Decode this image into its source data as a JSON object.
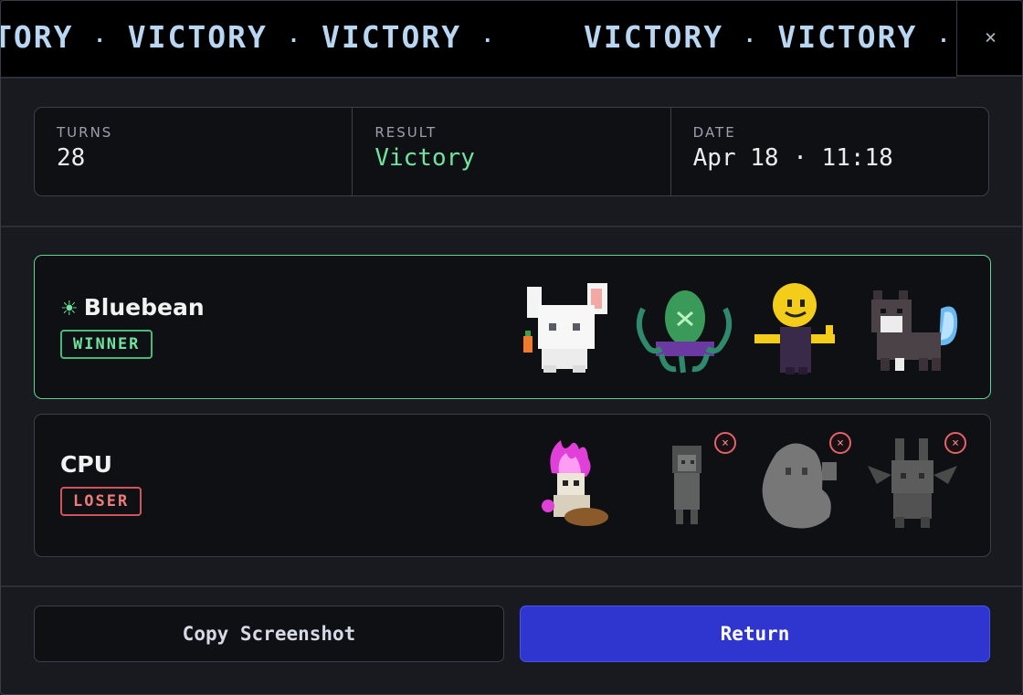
{
  "banner": {
    "word": "VICTORY",
    "separator": "·",
    "segments": [
      "TORY",
      "VICTORY",
      "VICTORY",
      "VICTORY",
      "VICTORY"
    ]
  },
  "close_label": "×",
  "stats": {
    "turns": {
      "label": "TURNS",
      "value": "28"
    },
    "result": {
      "label": "RESULT",
      "value": "Victory"
    },
    "date": {
      "label": "DATE",
      "value": "Apr 18 · 11:18"
    }
  },
  "winner": {
    "name": "Bluebean",
    "badge": "WINNER",
    "creatures": [
      {
        "name": "white-rabbit-sprite",
        "fainted": false
      },
      {
        "name": "green-octopus-sprite",
        "fainted": false
      },
      {
        "name": "yellow-smiley-mage-sprite",
        "fainted": false
      },
      {
        "name": "wolf-blue-flame-sprite",
        "fainted": false
      }
    ]
  },
  "loser": {
    "name": "CPU",
    "badge": "LOSER",
    "ko_mark": "×",
    "creatures": [
      {
        "name": "pink-flame-skeleton-sprite",
        "fainted": false
      },
      {
        "name": "ghost-girl-sprite",
        "fainted": true
      },
      {
        "name": "ghost-sprite",
        "fainted": true
      },
      {
        "name": "bat-beast-sprite",
        "fainted": true
      }
    ]
  },
  "buttons": {
    "copy": "Copy Screenshot",
    "return": "Return"
  },
  "colors": {
    "accent_green": "#6fe39f",
    "loser_red": "#ef7b7b",
    "return_blue": "#2f36d0",
    "banner_text": "#b9d6f2"
  }
}
